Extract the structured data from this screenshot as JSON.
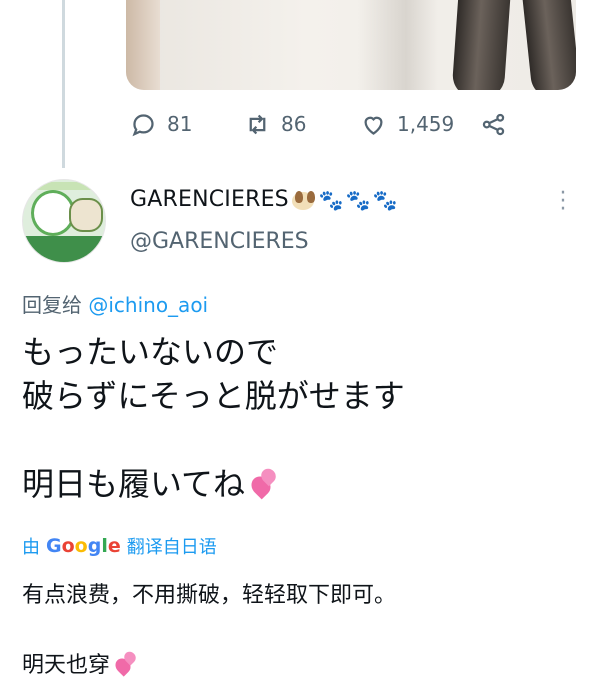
{
  "previous_tweet": {
    "actions": {
      "reply_count": "81",
      "retweet_count": "86",
      "like_count": "1,459"
    }
  },
  "tweet": {
    "display_name": "GARENCIERES",
    "name_emoji": "🐶🐾🐾🐾",
    "handle": "@GARENCIERES",
    "reply_prefix": "回复给",
    "reply_mention": "@ichino_aoi",
    "text_lines": [
      "もったいないので",
      "破らずにそっと脱がせます",
      "",
      "明日も履いてね"
    ],
    "translate": {
      "prefix": "由",
      "provider": "Google",
      "label": "翻译自日语"
    },
    "translation_line1": "有点浪费，不用撕破，轻轻取下即可。",
    "translation_line2": "明天也穿"
  },
  "icons": [
    "reply-icon",
    "retweet-icon",
    "like-icon",
    "share-icon",
    "more-icon",
    "heart-emoji-icon"
  ]
}
